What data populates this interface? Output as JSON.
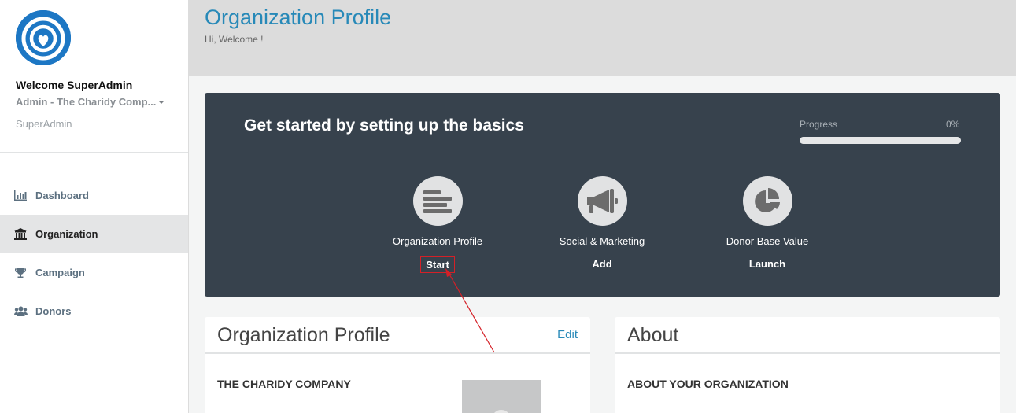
{
  "sidebar": {
    "welcome": "Welcome SuperAdmin",
    "org_selector": "Admin - The Charidy Comp...",
    "role": "SuperAdmin",
    "items": [
      {
        "label": "Dashboard",
        "icon": "bar-chart-icon"
      },
      {
        "label": "Organization",
        "icon": "bank-icon",
        "active": true
      },
      {
        "label": "Campaign",
        "icon": "trophy-icon"
      },
      {
        "label": "Donors",
        "icon": "users-icon"
      }
    ]
  },
  "header": {
    "title": "Organization Profile",
    "subtitle": "Hi, Welcome !"
  },
  "basics": {
    "title": "Get started by setting up the basics",
    "progress_label": "Progress",
    "progress_value": "0%",
    "progress_fraction": 0,
    "steps": [
      {
        "label": "Organization Profile",
        "action": "Start",
        "icon": "align-left-icon"
      },
      {
        "label": "Social & Marketing",
        "action": "Add",
        "icon": "megaphone-icon"
      },
      {
        "label": "Donor Base Value",
        "action": "Launch",
        "icon": "pie-chart-icon"
      }
    ]
  },
  "profile_card": {
    "title": "Organization Profile",
    "edit_label": "Edit",
    "org_name": "THE CHARIDY COMPANY"
  },
  "about_card": {
    "title": "About",
    "heading": "ABOUT YOUR ORGANIZATION"
  },
  "colors": {
    "accent": "#2789b8",
    "panel": "#37424d",
    "annotation": "#d42027"
  }
}
